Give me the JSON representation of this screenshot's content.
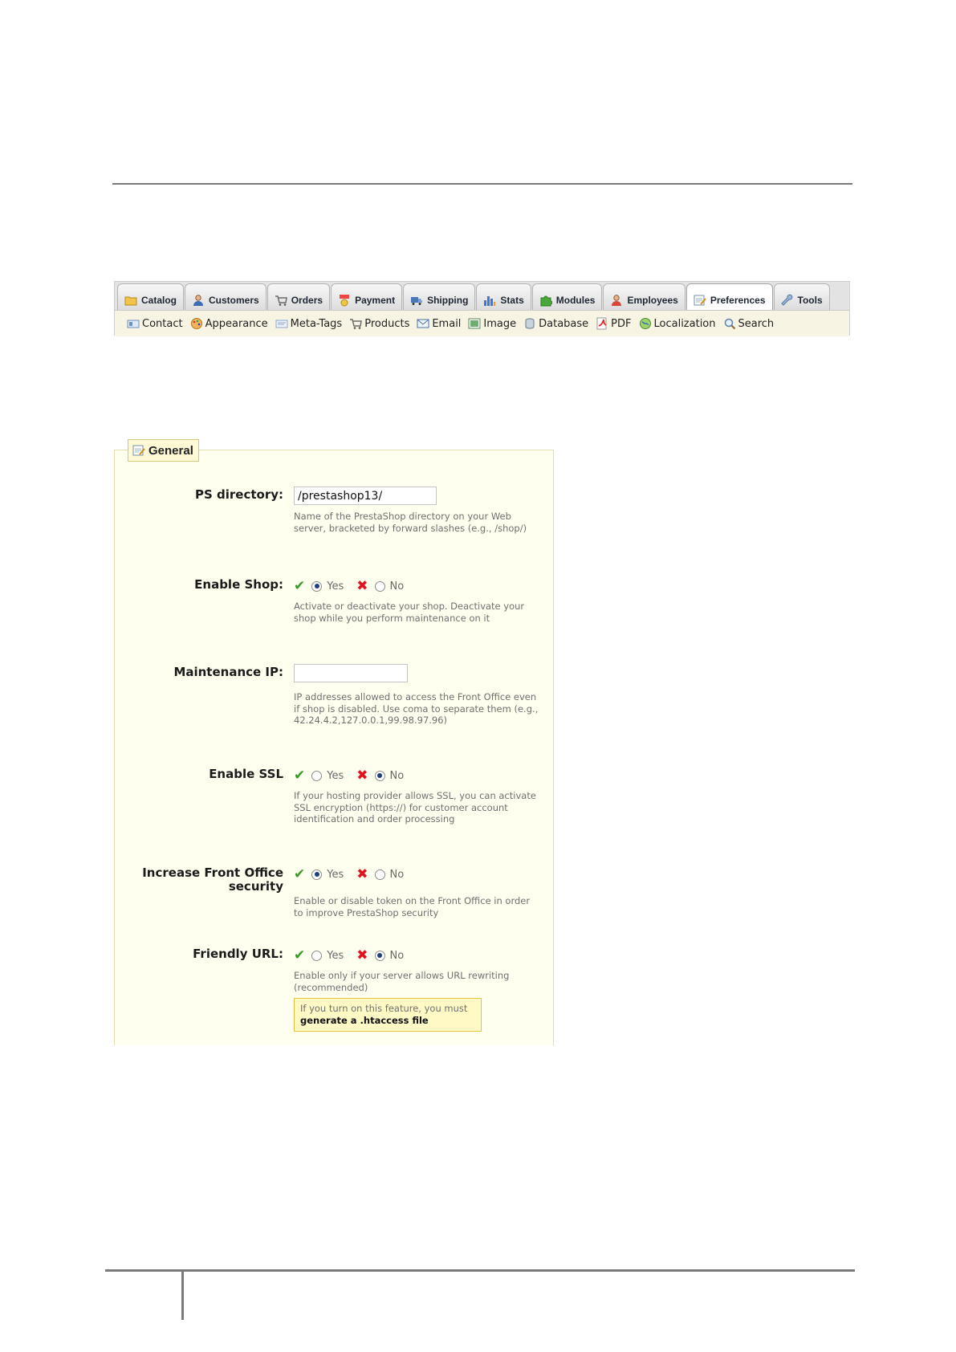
{
  "tabs": [
    {
      "label": "Catalog",
      "icon": "folder-icon",
      "active": false
    },
    {
      "label": "Customers",
      "icon": "customer-icon",
      "active": false
    },
    {
      "label": "Orders",
      "icon": "cart-icon",
      "active": false
    },
    {
      "label": "Payment",
      "icon": "payment-icon",
      "active": false
    },
    {
      "label": "Shipping",
      "icon": "truck-icon",
      "active": false
    },
    {
      "label": "Stats",
      "icon": "bar-chart-icon",
      "active": false
    },
    {
      "label": "Modules",
      "icon": "puzzle-icon",
      "active": false
    },
    {
      "label": "Employees",
      "icon": "employee-icon",
      "active": false
    },
    {
      "label": "Preferences",
      "icon": "preferences-icon",
      "active": true
    },
    {
      "label": "Tools",
      "icon": "wrench-icon",
      "active": false
    }
  ],
  "subnav": [
    {
      "label": "Contact",
      "icon": "contact-card-icon"
    },
    {
      "label": "Appearance",
      "icon": "palette-icon"
    },
    {
      "label": "Meta-Tags",
      "icon": "meta-tags-icon"
    },
    {
      "label": "Products",
      "icon": "cart-icon"
    },
    {
      "label": "Email",
      "icon": "envelope-icon"
    },
    {
      "label": "Image",
      "icon": "image-icon"
    },
    {
      "label": "Database",
      "icon": "database-icon"
    },
    {
      "label": "PDF",
      "icon": "pdf-icon"
    },
    {
      "label": "Localization",
      "icon": "globe-icon"
    },
    {
      "label": "Search",
      "icon": "magnifier-icon"
    }
  ],
  "panel": {
    "legend": "General",
    "ps_directory": {
      "label": "PS directory:",
      "value": "/prestashop13/",
      "help": "Name of the PrestaShop directory on your Web server, bracketed by forward slashes (e.g., /shop/)"
    },
    "enable_shop": {
      "label": "Enable Shop:",
      "yes": "Yes",
      "no": "No",
      "selected": "yes",
      "help": "Activate or deactivate your shop. Deactivate your shop while you perform maintenance on it"
    },
    "maintenance_ip": {
      "label": "Maintenance IP:",
      "value": "",
      "help": "IP addresses allowed to access the Front Office even if shop is disabled. Use coma to separate them (e.g., 42.24.4.2,127.0.0.1,99.98.97.96)"
    },
    "enable_ssl": {
      "label": "Enable SSL",
      "yes": "Yes",
      "no": "No",
      "selected": "no",
      "help": "If your hosting provider allows SSL, you can activate SSL encryption (https://) for customer account identification and order processing"
    },
    "fo_security": {
      "label": "Increase Front Office security",
      "yes": "Yes",
      "no": "No",
      "selected": "yes",
      "help": "Enable or disable token on the Front Office in order to improve PrestaShop security"
    },
    "friendly_url": {
      "label": "Friendly URL:",
      "yes": "Yes",
      "no": "No",
      "selected": "no",
      "help": "Enable only if your server allows URL rewriting (recommended)",
      "notice_text": "If you turn on this feature, you must",
      "notice_link": "generate a .htaccess file"
    }
  },
  "colors": {
    "panel_bg": "#fffff0",
    "check_green": "#3a9a26",
    "cross_red": "#e0141e",
    "notice_bg": "#fff9c6"
  }
}
